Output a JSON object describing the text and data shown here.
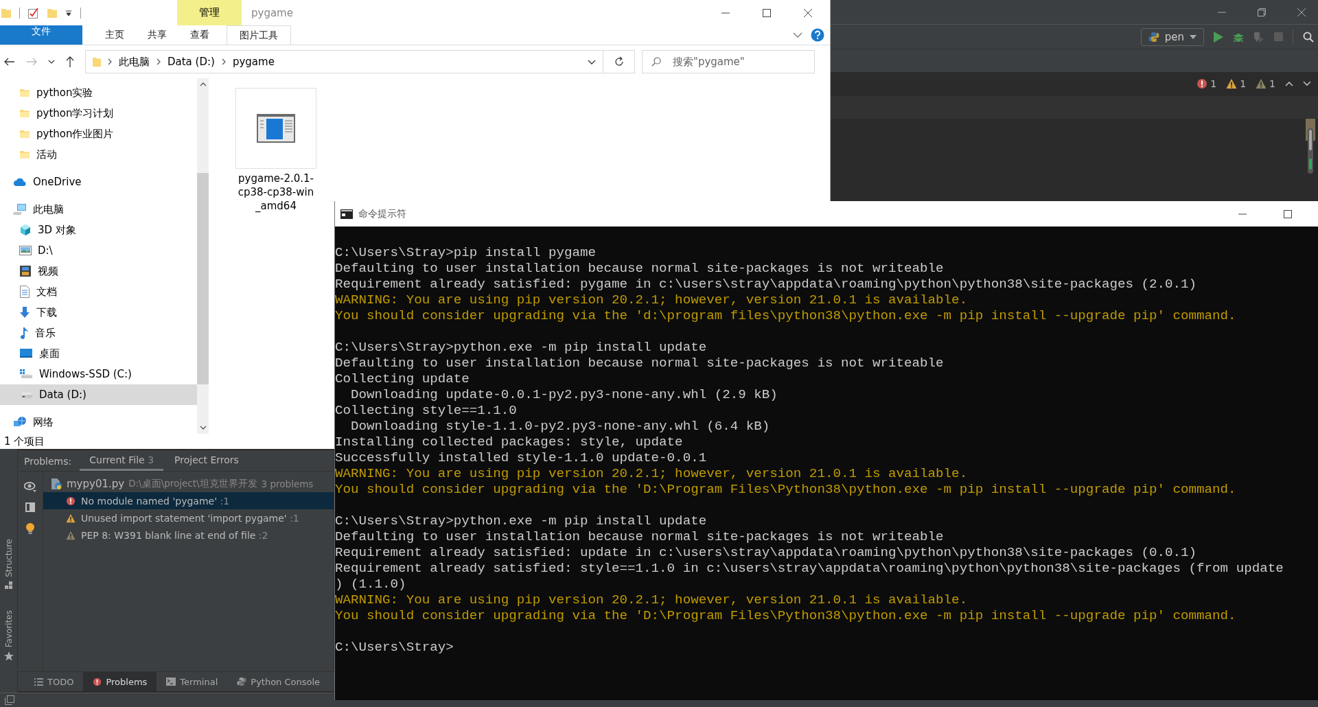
{
  "ide": {
    "run_config": "pen",
    "inspections": [
      {
        "kind": "error",
        "count": "1"
      },
      {
        "kind": "warning",
        "count": "1"
      },
      {
        "kind": "weak",
        "count": "1"
      }
    ],
    "side_tools": [
      {
        "label": "Structure",
        "kind": "structure"
      },
      {
        "label": "Favorites",
        "kind": "favorites"
      }
    ],
    "problems": {
      "label": "Problems:",
      "tabs": [
        {
          "label": "Current File",
          "count": "3",
          "selected": true
        },
        {
          "label": "Project Errors",
          "selected": false
        }
      ],
      "file": {
        "name": "mypy01.py",
        "path": "D:\\桌面\\project\\坦克世界开发",
        "summary": "3 problems"
      },
      "items": [
        {
          "kind": "error",
          "text": "No module named 'pygame'",
          "line": ":1",
          "selected": true
        },
        {
          "kind": "warning",
          "text": "Unused import statement 'import pygame'",
          "line": ":1",
          "selected": false
        },
        {
          "kind": "weak",
          "text": "PEP 8: W391 blank line at end of file",
          "line": ":2",
          "selected": false
        }
      ]
    },
    "tool_windows": [
      {
        "label": "TODO",
        "kind": "todo",
        "selected": false
      },
      {
        "label": "Problems",
        "kind": "problems",
        "selected": true
      },
      {
        "label": "Terminal",
        "kind": "terminal",
        "selected": false
      },
      {
        "label": "Python Console",
        "kind": "console",
        "selected": false
      }
    ]
  },
  "explorer": {
    "title": "pygame",
    "context_header": "管理",
    "ribbon_tabs": [
      {
        "label": "文件",
        "kind": "file"
      },
      {
        "label": "主页",
        "kind": "tab"
      },
      {
        "label": "共享",
        "kind": "tab"
      },
      {
        "label": "查看",
        "kind": "tab"
      },
      {
        "label": "图片工具",
        "kind": "context"
      }
    ],
    "breadcrumbs": [
      "此电脑",
      "Data (D:)",
      "pygame"
    ],
    "search": {
      "placeholder": "搜索\"pygame\""
    },
    "quick_access": [
      {
        "label": "python实验",
        "kind": "folder",
        "selected": false
      },
      {
        "label": "python学习计划",
        "kind": "folder",
        "selected": false
      },
      {
        "label": "python作业图片",
        "kind": "folder",
        "selected": false
      },
      {
        "label": "活动",
        "kind": "folder",
        "selected": false
      }
    ],
    "nav_tree": [
      {
        "label": "OneDrive",
        "kind": "cloud",
        "selected": false
      },
      {
        "label": "此电脑",
        "kind": "pc",
        "selected": false,
        "children": [
          {
            "label": "3D 对象",
            "kind": "cube",
            "selected": false
          },
          {
            "label": "D:\\",
            "kind": "image",
            "selected": false
          },
          {
            "label": "视频",
            "kind": "film",
            "selected": false
          },
          {
            "label": "文档",
            "kind": "doc",
            "selected": false
          },
          {
            "label": "下载",
            "kind": "download",
            "selected": false
          },
          {
            "label": "音乐",
            "kind": "music",
            "selected": false
          },
          {
            "label": "桌面",
            "kind": "desktop",
            "selected": false
          },
          {
            "label": "Windows-SSD (C:)",
            "kind": "windrive",
            "selected": false
          },
          {
            "label": "Data (D:)",
            "kind": "drive",
            "selected": true
          }
        ]
      },
      {
        "label": "网络",
        "kind": "network",
        "selected": false
      }
    ],
    "files": [
      {
        "name": "pygame-2.0.1-cp38-cp38-win_amd64"
      }
    ],
    "status": "1 个项目"
  },
  "cmd": {
    "title": "命令提示符",
    "blocks": [
      [
        {
          "kind": "prompt",
          "text": "C:\\Users\\Stray>pip install pygame"
        },
        {
          "kind": "text",
          "text": "Defaulting to user installation because normal site-packages is not writeable"
        },
        {
          "kind": "text",
          "text": "Requirement already satisfied: pygame in c:\\users\\stray\\appdata\\roaming\\python\\python38\\site-packages (2.0.1)"
        },
        {
          "kind": "warning",
          "text": "WARNING: You are using pip version 20.2.1; however, version 21.0.1 is available."
        },
        {
          "kind": "warning",
          "text": "You should consider upgrading via the 'd:\\program files\\python38\\python.exe -m pip install --upgrade pip' command."
        }
      ],
      [
        {
          "kind": "prompt",
          "text": "C:\\Users\\Stray>python.exe -m pip install update"
        },
        {
          "kind": "text",
          "text": "Defaulting to user installation because normal site-packages is not writeable"
        },
        {
          "kind": "text",
          "text": "Collecting update"
        },
        {
          "kind": "text",
          "text": "  Downloading update-0.0.1-py2.py3-none-any.whl (2.9 kB)"
        },
        {
          "kind": "text",
          "text": "Collecting style==1.1.0"
        },
        {
          "kind": "text",
          "text": "  Downloading style-1.1.0-py2.py3-none-any.whl (6.4 kB)"
        },
        {
          "kind": "text",
          "text": "Installing collected packages: style, update"
        },
        {
          "kind": "text",
          "text": "Successfully installed style-1.1.0 update-0.0.1"
        },
        {
          "kind": "warning",
          "text": "WARNING: You are using pip version 20.2.1; however, version 21.0.1 is available."
        },
        {
          "kind": "warning",
          "text": "You should consider upgrading via the 'D:\\Program Files\\Python38\\python.exe -m pip install --upgrade pip' command."
        }
      ],
      [
        {
          "kind": "prompt",
          "text": "C:\\Users\\Stray>python.exe -m pip install update"
        },
        {
          "kind": "text",
          "text": "Defaulting to user installation because normal site-packages is not writeable"
        },
        {
          "kind": "text",
          "text": "Requirement already satisfied: update in c:\\users\\stray\\appdata\\roaming\\python\\python38\\site-packages (0.0.1)"
        },
        {
          "kind": "text",
          "text": "Requirement already satisfied: style==1.1.0 in c:\\users\\stray\\appdata\\roaming\\python\\python38\\site-packages (from update"
        },
        {
          "kind": "text",
          "text": ") (1.1.0)"
        },
        {
          "kind": "warning",
          "text": "WARNING: You are using pip version 20.2.1; however, version 21.0.1 is available."
        },
        {
          "kind": "warning",
          "text": "You should consider upgrading via the 'D:\\Program Files\\Python38\\python.exe -m pip install --upgrade pip' command."
        }
      ],
      [
        {
          "kind": "prompt",
          "text": "C:\\Users\\Stray>"
        }
      ]
    ]
  }
}
